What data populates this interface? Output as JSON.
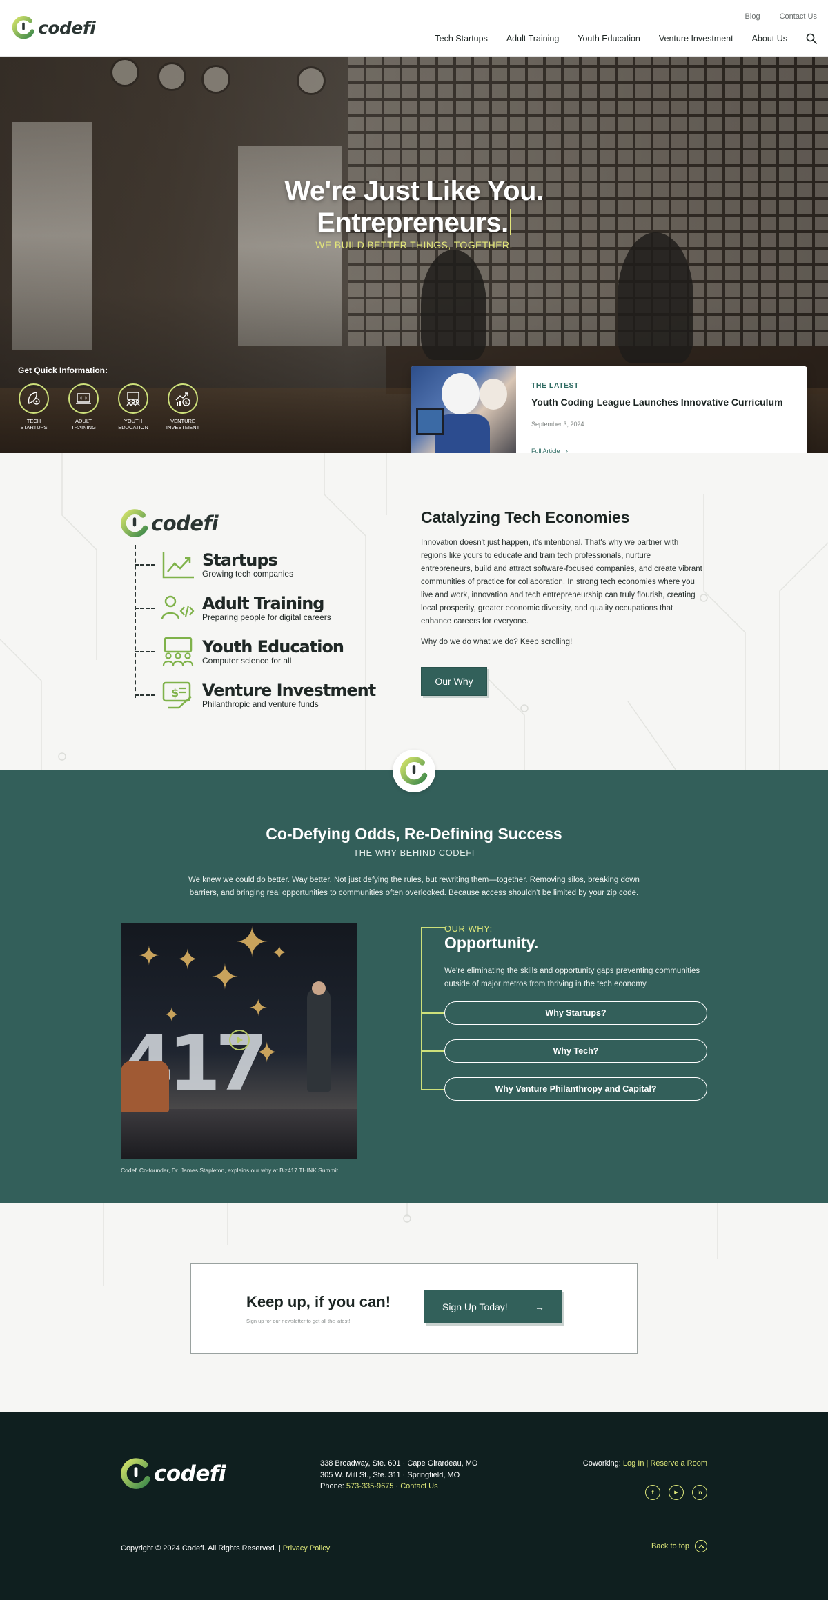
{
  "header": {
    "logo_text": "codefi",
    "utility_links": [
      "Blog",
      "Contact Us"
    ],
    "nav_items": [
      "Tech Startups",
      "Adult Training",
      "Youth Education",
      "Venture Investment",
      "About Us"
    ]
  },
  "hero": {
    "title_line1": "We're Just Like You.",
    "title_line2": "Entrepreneurs.",
    "subtitle": "WE BUILD BETTER THINGS, TOGETHER.",
    "quick_info": {
      "title": "Get Quick Information:",
      "items": [
        {
          "label": "TECH\nSTARTUPS",
          "icon": "rocket-gear-icon"
        },
        {
          "label": "ADULT\nTRAINING",
          "icon": "laptop-code-icon"
        },
        {
          "label": "YOUTH\nEDUCATION",
          "icon": "classroom-icon"
        },
        {
          "label": "VENTURE\nINVESTMENT",
          "icon": "growth-dollar-icon"
        }
      ]
    },
    "latest": {
      "kicker": "THE LATEST",
      "title": "Youth Coding League Launches Innovative Curriculum",
      "date": "September 3, 2024",
      "link": "Full Article"
    }
  },
  "catalyze": {
    "logo_text": "codefi",
    "pillars": [
      {
        "title": "Startups",
        "subtitle": "Growing tech companies",
        "icon": "chart-up-icon"
      },
      {
        "title": "Adult Training",
        "subtitle": "Preparing people for digital careers",
        "icon": "person-code-icon"
      },
      {
        "title": "Youth Education",
        "subtitle": "Computer science for all",
        "icon": "classroom-icon"
      },
      {
        "title": "Venture Investment",
        "subtitle": "Philanthropic and venture funds",
        "icon": "hand-dollar-icon"
      }
    ],
    "heading": "Catalyzing Tech Economies",
    "body": "Innovation doesn't just happen, it's intentional. That's why we partner with regions like yours to educate and train tech professionals, nurture entrepreneurs, build and attract software-focused companies, and create vibrant communities of practice for collaboration. In strong tech economies where you live and work, innovation and tech entrepreneurship can truly flourish, creating local prosperity, greater economic diversity, and quality occupations that enhance careers for everyone.",
    "body2": "Why do we do what we do? Keep scrolling!",
    "button": "Our Why"
  },
  "why": {
    "title": "Co-Defying Odds, Re-Defining Success",
    "subtitle": "THE WHY BEHIND CODEFI",
    "body": "We knew we could do better. Way better. Not just defying the rules, but rewriting them—together. Removing silos, breaking down barriers, and bringing real opportunities to communities often overlooked. Because access shouldn't be limited by your zip code.",
    "video_caption": "Codefi Co-founder, Dr. James Stapleton, explains our why at Biz417 THINK Summit.",
    "video_text": "417",
    "kicker": "OUR WHY:",
    "heading": "Opportunity.",
    "text": "We're eliminating the skills and opportunity gaps preventing communities outside of major metros from thriving in the tech economy.",
    "buttons": [
      "Why Startups?",
      "Why Tech?",
      "Why Venture Philanthropy and Capital?"
    ]
  },
  "newsletter": {
    "title": "Keep up, if you can!",
    "subtitle": "Sign up for our newsletter to get all the latest!",
    "button": "Sign Up Today!",
    "button_arrow": "→"
  },
  "footer": {
    "logo_text": "codefi",
    "address1": "338 Broadway, Ste. 601 · Cape Girardeau, MO",
    "address2": "305 W. Mill St., Ste. 311 · Springfield, MO",
    "phone_label": "Phone: ",
    "phone": "573-335-9675",
    "separator": " · ",
    "contact": "Contact Us",
    "cowork_label": "Coworking: ",
    "login": "Log In",
    "pipe": " | ",
    "reserve": "Reserve a Room",
    "socials": [
      {
        "name": "facebook-icon",
        "glyph": "f"
      },
      {
        "name": "youtube-icon",
        "glyph": "▶"
      },
      {
        "name": "linkedin-icon",
        "glyph": "in"
      }
    ],
    "copyright": "Copyright © 2024 Codefi. All Rights Reserved. | ",
    "privacy": "Privacy Policy",
    "back_to_top": "Back to top"
  },
  "colors": {
    "brand_green": "#335f5a",
    "accent_yellow": "#dfe87a",
    "logo_green": "#7fb24a",
    "footer_dark": "#0f1f1f"
  }
}
